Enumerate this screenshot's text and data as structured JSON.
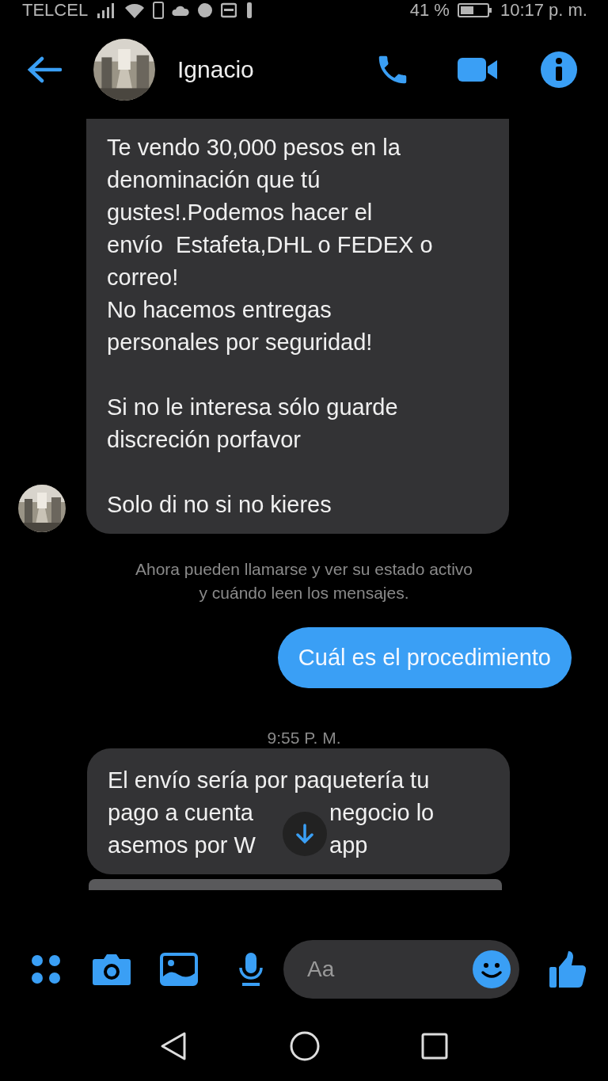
{
  "status_bar": {
    "carrier": "TELCEL",
    "battery": "41 %",
    "time": "10:17 p. m."
  },
  "header": {
    "contact": "Ignacio"
  },
  "messages": [
    {
      "kind": "received",
      "avatar": true,
      "paragraphs": [
        [
          [
            "Te vendo 30,000 pesos en la"
          ],
          [
            "denominación que tú"
          ],
          [
            "gustes!.Podemos hacer el"
          ],
          [
            "envío  Estafeta,DHL o FEDEX o"
          ],
          [
            "correo!"
          ],
          [
            "No hacemos entregas"
          ],
          [
            "personales por seguridad!"
          ]
        ],
        [
          [
            "Si no le interesa sólo guarde"
          ],
          [
            "discreción porfavor"
          ]
        ],
        [
          [
            "Solo di no si no kieres"
          ]
        ]
      ]
    },
    {
      "kind": "notice",
      "lines": [
        "Ahora pueden llamarse y ver su estado activo",
        "y cuándo leen los mensajes."
      ]
    },
    {
      "kind": "sent",
      "text": "Cuál es el procedimiento"
    },
    {
      "kind": "time",
      "text": "9:55 P. M."
    },
    {
      "kind": "received",
      "avatar": false,
      "paragraphs": [
        [
          [
            "El envío sería por paquetería tu"
          ],
          [
            "pago a cuenta",
            "negocio lo"
          ],
          [
            "asemos por W",
            "app"
          ]
        ]
      ]
    }
  ],
  "composer": {
    "placeholder": "Aa"
  }
}
